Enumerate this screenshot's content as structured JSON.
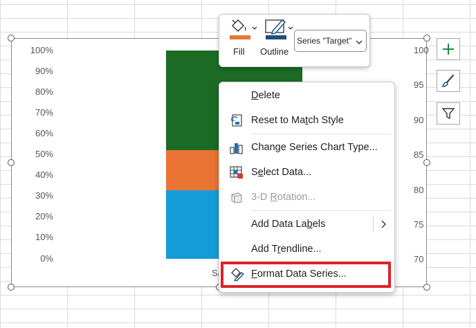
{
  "chart": {
    "left_axis_ticks": [
      "100%",
      "90%",
      "80%",
      "70%",
      "60%",
      "50%",
      "40%",
      "30%",
      "20%",
      "10%",
      "0%"
    ],
    "right_axis_ticks": [
      "100",
      "95",
      "90",
      "85",
      "80",
      "75",
      "70"
    ],
    "x_label_partial": "Sa",
    "colors": {
      "segment_blue": "#139dd8",
      "segment_orange": "#ea7434",
      "segment_green": "#1b6b26"
    }
  },
  "chart_data": {
    "type": "bar",
    "stacked": true,
    "percent": true,
    "categories": [
      "Sa"
    ],
    "series": [
      {
        "values": [
          33
        ]
      },
      {
        "values": [
          19
        ]
      },
      {
        "values": [
          48
        ]
      }
    ],
    "ylim": [
      0,
      100
    ],
    "y2lim": [
      70,
      100
    ]
  },
  "mini_toolbar": {
    "fill_label": "Fill",
    "outline_label": "Outline",
    "series_select_value": "Series \"Target\"",
    "fill_color": "#ea7434",
    "outline_color": "#1f4e79"
  },
  "context_menu": {
    "items": [
      {
        "pre": "",
        "u": "D",
        "post": "elete",
        "icon": "none",
        "disabled": false
      },
      {
        "pre": "Reset to Ma",
        "u": "t",
        "post": "ch Style",
        "icon": "reset-style-icon",
        "disabled": false
      },
      {
        "pre": "Change Series Chart Type...",
        "u": "",
        "post": "",
        "icon": "chart-type-icon",
        "disabled": false
      },
      {
        "pre": "S",
        "u": "e",
        "post": "lect Data...",
        "icon": "select-data-icon",
        "disabled": false
      },
      {
        "pre": "3-D ",
        "u": "R",
        "post": "otation...",
        "icon": "rotation-icon",
        "disabled": true
      },
      {
        "pre": "Add Data La",
        "u": "b",
        "post": "els",
        "icon": "none",
        "disabled": false
      },
      {
        "pre": "Add T",
        "u": "r",
        "post": "endline...",
        "icon": "none",
        "disabled": false
      },
      {
        "pre": "",
        "u": "F",
        "post": "ormat Data Series...",
        "icon": "format-series-icon",
        "disabled": false
      }
    ]
  }
}
